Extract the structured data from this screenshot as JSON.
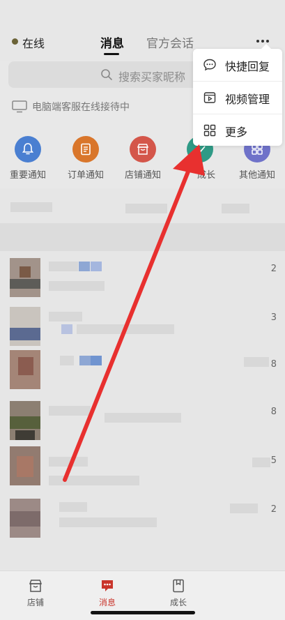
{
  "header": {
    "status": "在线",
    "tabs": [
      {
        "label": "消息",
        "active": true
      },
      {
        "label": "官方会话",
        "active": false
      }
    ],
    "more_icon": "more-horizontal-icon"
  },
  "search": {
    "placeholder": "搜索买家昵称",
    "icon": "search-icon"
  },
  "pc_status": {
    "text": "电脑端客服在线接待中",
    "icon": "monitor-icon"
  },
  "notifications": [
    {
      "label": "重要通知",
      "icon": "bell-icon",
      "color": "#4a7fd1"
    },
    {
      "label": "订单通知",
      "icon": "order-doc-icon",
      "color": "#d9762b"
    },
    {
      "label": "店铺通知",
      "icon": "store-icon",
      "color": "#d4564a"
    },
    {
      "label": "成长",
      "icon": "growth-icon",
      "color": "#2f9a86"
    },
    {
      "label": "其他通知",
      "icon": "grid-icon",
      "color": "#6f72c9"
    }
  ],
  "popup_menu": {
    "items": [
      {
        "label": "快捷回复",
        "icon": "chat-bubble-icon"
      },
      {
        "label": "视频管理",
        "icon": "video-icon"
      },
      {
        "label": "更多",
        "icon": "grid-icon"
      }
    ]
  },
  "chats": {
    "unread_counts": [
      "2",
      "3",
      "8",
      "8",
      "5",
      "2"
    ]
  },
  "bottom_nav": {
    "items": [
      {
        "label": "店铺",
        "icon": "store-icon",
        "active": false
      },
      {
        "label": "消息",
        "icon": "message-icon",
        "active": true
      },
      {
        "label": "成长",
        "icon": "bookmark-icon",
        "active": false
      }
    ],
    "active_color": "#c9352b"
  },
  "annotation": {
    "arrow_color": "#e8302f"
  }
}
